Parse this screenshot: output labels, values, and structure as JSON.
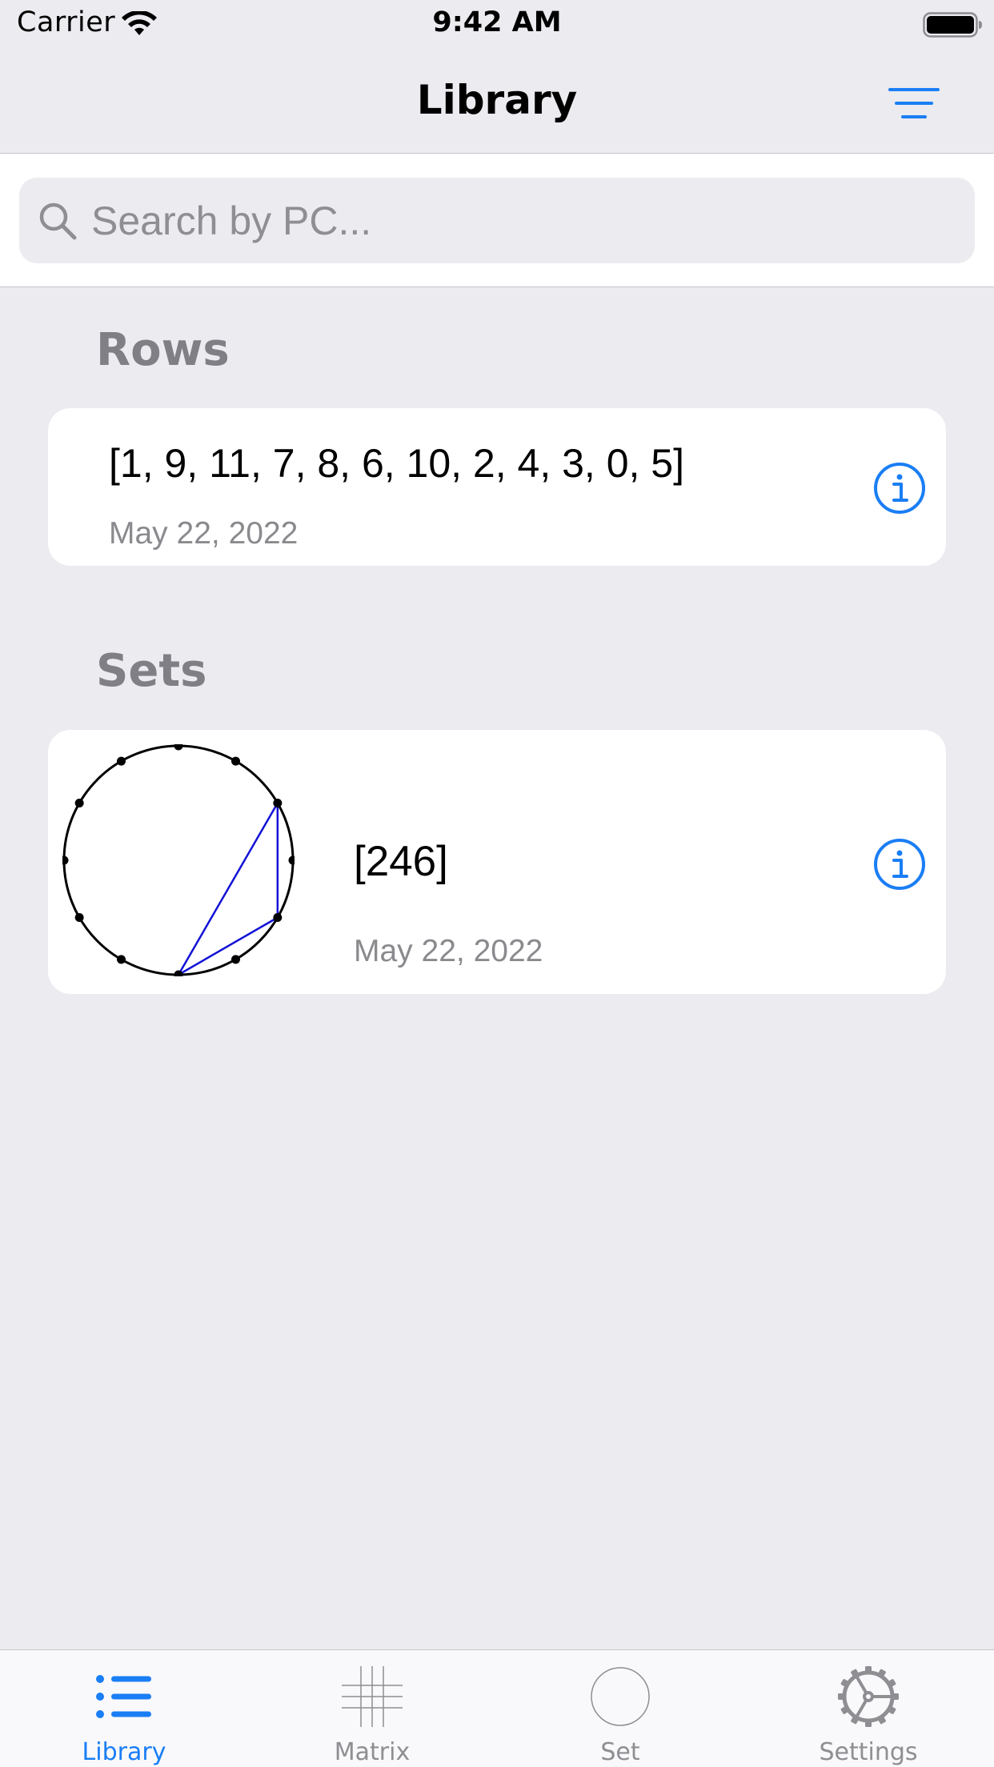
{
  "status_bar": {
    "carrier": "Carrier",
    "time": "9:42 AM"
  },
  "nav": {
    "title": "Library",
    "filter_icon": "filter-lines-icon"
  },
  "search": {
    "placeholder": "Search by PC...",
    "value": ""
  },
  "sections": {
    "rows": {
      "header": "Rows",
      "items": [
        {
          "sequence": "[1, 9, 11, 7, 8, 6, 10, 2, 4, 3, 0, 5]",
          "date": "May 22, 2022"
        }
      ]
    },
    "sets": {
      "header": "Sets",
      "items": [
        {
          "name": "[246]",
          "date": "May 22, 2022",
          "pitch_classes": [
            2,
            4,
            6
          ]
        }
      ]
    }
  },
  "tabs": [
    {
      "label": "Library",
      "icon": "list-icon",
      "active": true
    },
    {
      "label": "Matrix",
      "icon": "grid-icon",
      "active": false
    },
    {
      "label": "Set",
      "icon": "circle-icon",
      "active": false
    },
    {
      "label": "Settings",
      "icon": "gear-icon",
      "active": false
    }
  ],
  "colors": {
    "accent": "#1a7ef5",
    "background": "#ebebf0",
    "set_polygon": "#1212d6",
    "secondary_text": "#8a8a8e"
  }
}
